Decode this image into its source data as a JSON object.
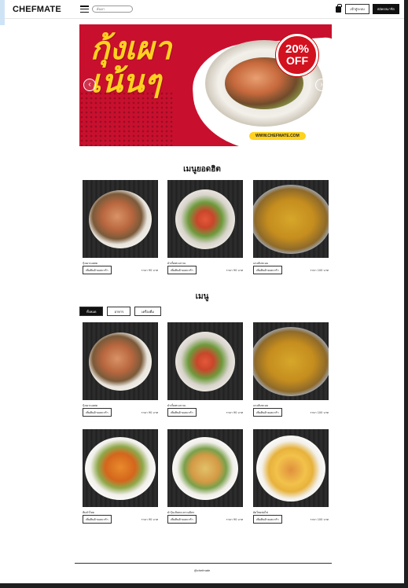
{
  "header": {
    "logo": "CHEFMATE",
    "search_placeholder": "ค้นหา",
    "login_label": "เข้าสู่ระบบ",
    "register_label": "สมัครสมาชิก"
  },
  "banner": {
    "title_line1": "กุ้งเผา",
    "title_line2": "เน้นๆ",
    "discount_pct": "20%",
    "discount_off": "OFF",
    "url": "WWW.CHEFMATE.COM"
  },
  "bestsellers": {
    "title": "เมนูยอดฮิต",
    "items": [
      {
        "name": "กุ้งเผาเนยสด",
        "add_label": "เพิ่มสินค้าลงตะกร้า",
        "price": "ราคา 90 บาท",
        "dish": "shrimp"
      },
      {
        "name": "ยำเห็ดทะเลรวม",
        "add_label": "เพิ่มสินค้าลงตะกร้า",
        "price": "ราคา 90 บาท",
        "dish": "salad"
      },
      {
        "name": "แกงส้มชะอม",
        "add_label": "เพิ่มสินค้าลงตะกร้า",
        "price": "ราคา 100 บาท",
        "dish": "curry"
      }
    ]
  },
  "menu": {
    "title": "เมนู",
    "filters": [
      "ทั้งหมด",
      "อาหาร",
      "เครื่องดื่ม"
    ],
    "active_filter": "ทั้งหมด",
    "items": [
      {
        "name": "กุ้งเผาเนยสด",
        "add_label": "เพิ่มสินค้าลงตะกร้า",
        "price": "ราคา 90 บาท",
        "dish": "shrimp"
      },
      {
        "name": "ยำเห็ดทะเลรวม",
        "add_label": "เพิ่มสินค้าลงตะกร้า",
        "price": "ราคา 90 บาท",
        "dish": "salad"
      },
      {
        "name": "แกงส้มชะอม",
        "add_label": "เพิ่มสินค้าลงตะกร้า",
        "price": "ราคา 100 บาท",
        "dish": "curry"
      },
      {
        "name": "ส้มตำไทย",
        "add_label": "เพิ่มสินค้าลงตะกร้า",
        "price": "ราคา 90 บาท",
        "dish": "somtam"
      },
      {
        "name": "ยำวุ้นเส้นทะเลรวมมิตร",
        "add_label": "เพิ่มสินค้าลงตะกร้า",
        "price": "ราคา 90 บาท",
        "dish": "yumwoonsen"
      },
      {
        "name": "ผัดไทยห่อไข่",
        "add_label": "เพิ่มสินค้าลงตะกร้า",
        "price": "ราคา 100 บาท",
        "dish": "padthai"
      }
    ]
  },
  "footer": {
    "text": "@chefmate"
  },
  "colors": {
    "banner_red": "#c8102e",
    "banner_yellow": "#ffd21f",
    "dark": "#111111"
  }
}
